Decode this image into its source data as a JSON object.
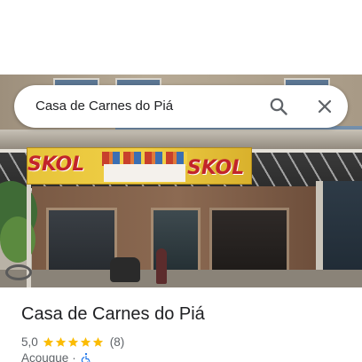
{
  "search": {
    "query": "Casa de Carnes do Piá"
  },
  "photo": {
    "banner_text_left": "SKOL",
    "banner_text_right": "SKOL"
  },
  "place": {
    "name": "Casa de Carnes do Piá",
    "rating": "5,0",
    "stars": 5,
    "reviews": "(8)",
    "category": "Açougue",
    "separator": "·"
  },
  "icons": {
    "search": "search-icon",
    "close": "close-icon",
    "star": "star-icon",
    "accessibility": "wheelchair-icon"
  },
  "colors": {
    "star": "#fbbc04",
    "icon": "#5f6368",
    "accessible": "#1a73e8"
  }
}
